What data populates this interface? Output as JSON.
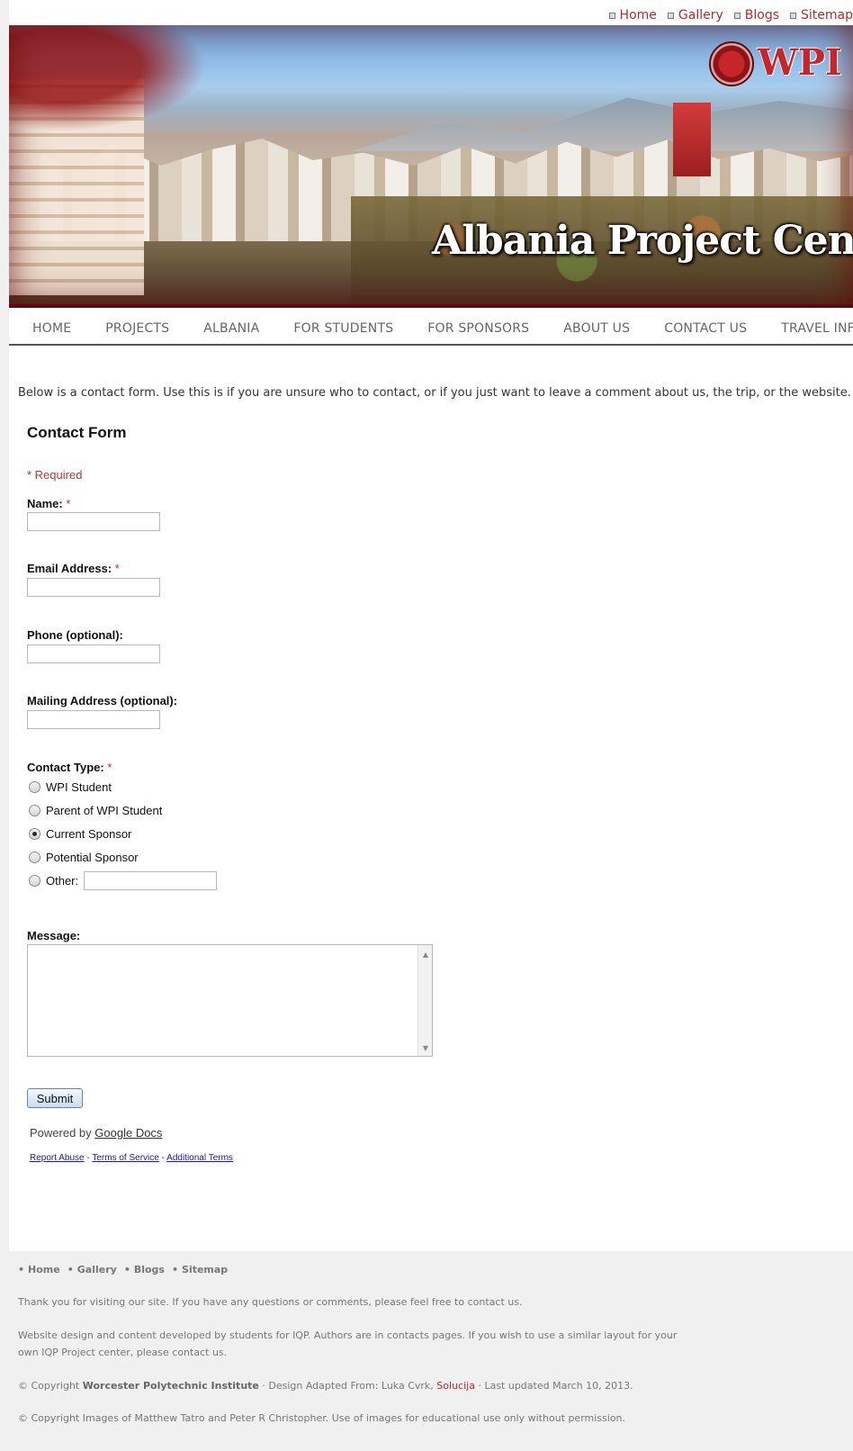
{
  "top_links": [
    "Home",
    "Gallery",
    "Blogs",
    "Sitemap"
  ],
  "banner": {
    "title": "Albania Project Center",
    "logo_text": "WPI"
  },
  "nav": [
    "HOME",
    "PROJECTS",
    "ALBANIA",
    "FOR STUDENTS",
    "FOR SPONSORS",
    "ABOUT US",
    "CONTACT US",
    "TRAVEL INFO"
  ],
  "intro": "Below is a contact form. Use this is if you are unsure who to contact, or if you just want to leave a comment about us, the trip, or the website.",
  "form": {
    "title": "Contact Form",
    "required_note": "* Required",
    "name_label": "Name:",
    "email_label": "Email Address:",
    "phone_label": "Phone (optional):",
    "mailing_label": "Mailing Address (optional):",
    "contact_type_label": "Contact Type:",
    "required_marker": "*",
    "contact_types": [
      "WPI Student",
      "Parent of WPI Student",
      "Current Sponsor",
      "Potential Sponsor",
      "Other:"
    ],
    "contact_type_selected": "Current Sponsor",
    "message_label": "Message:",
    "submit_label": "Submit",
    "powered_prefix": "Powered by",
    "powered_link": "Google Docs",
    "report_abuse": "Report Abuse",
    "terms_of_service": "Terms of Service",
    "additional_terms": "Additional Terms",
    "separator": "-",
    "name_value": "",
    "email_value": "",
    "phone_value": "",
    "mailing_value": "",
    "other_value": "",
    "message_value": ""
  },
  "footer": {
    "links": [
      "Home",
      "Gallery",
      "Blogs",
      "Sitemap"
    ],
    "thanks": "Thank you for visiting our site. If you have any questions or comments, please feel free to contact us.",
    "design_line1": "Website design and content developed by students for IQP. Authors are in contacts pages. If you wish to use a similar layout for your",
    "design_line2": "own IQP Project center, please contact us.",
    "copyright_prefix": "© Copyright",
    "copyright_org": "Worcester Polytechnic Institute",
    "copyright_mid": "· Design Adapted From: Luka Cvrk,",
    "copyright_link": "Solucija",
    "copyright_suffix": "· Last updated March 10, 2013.",
    "images_copyright": "© Copyright Images of Matthew Tatro and Peter R Christopher. Use of images for educational use only without permission."
  },
  "colors": {
    "accent_red": "#c0242a",
    "nav_text": "#666666",
    "footer_bg": "#f0f0f0"
  }
}
